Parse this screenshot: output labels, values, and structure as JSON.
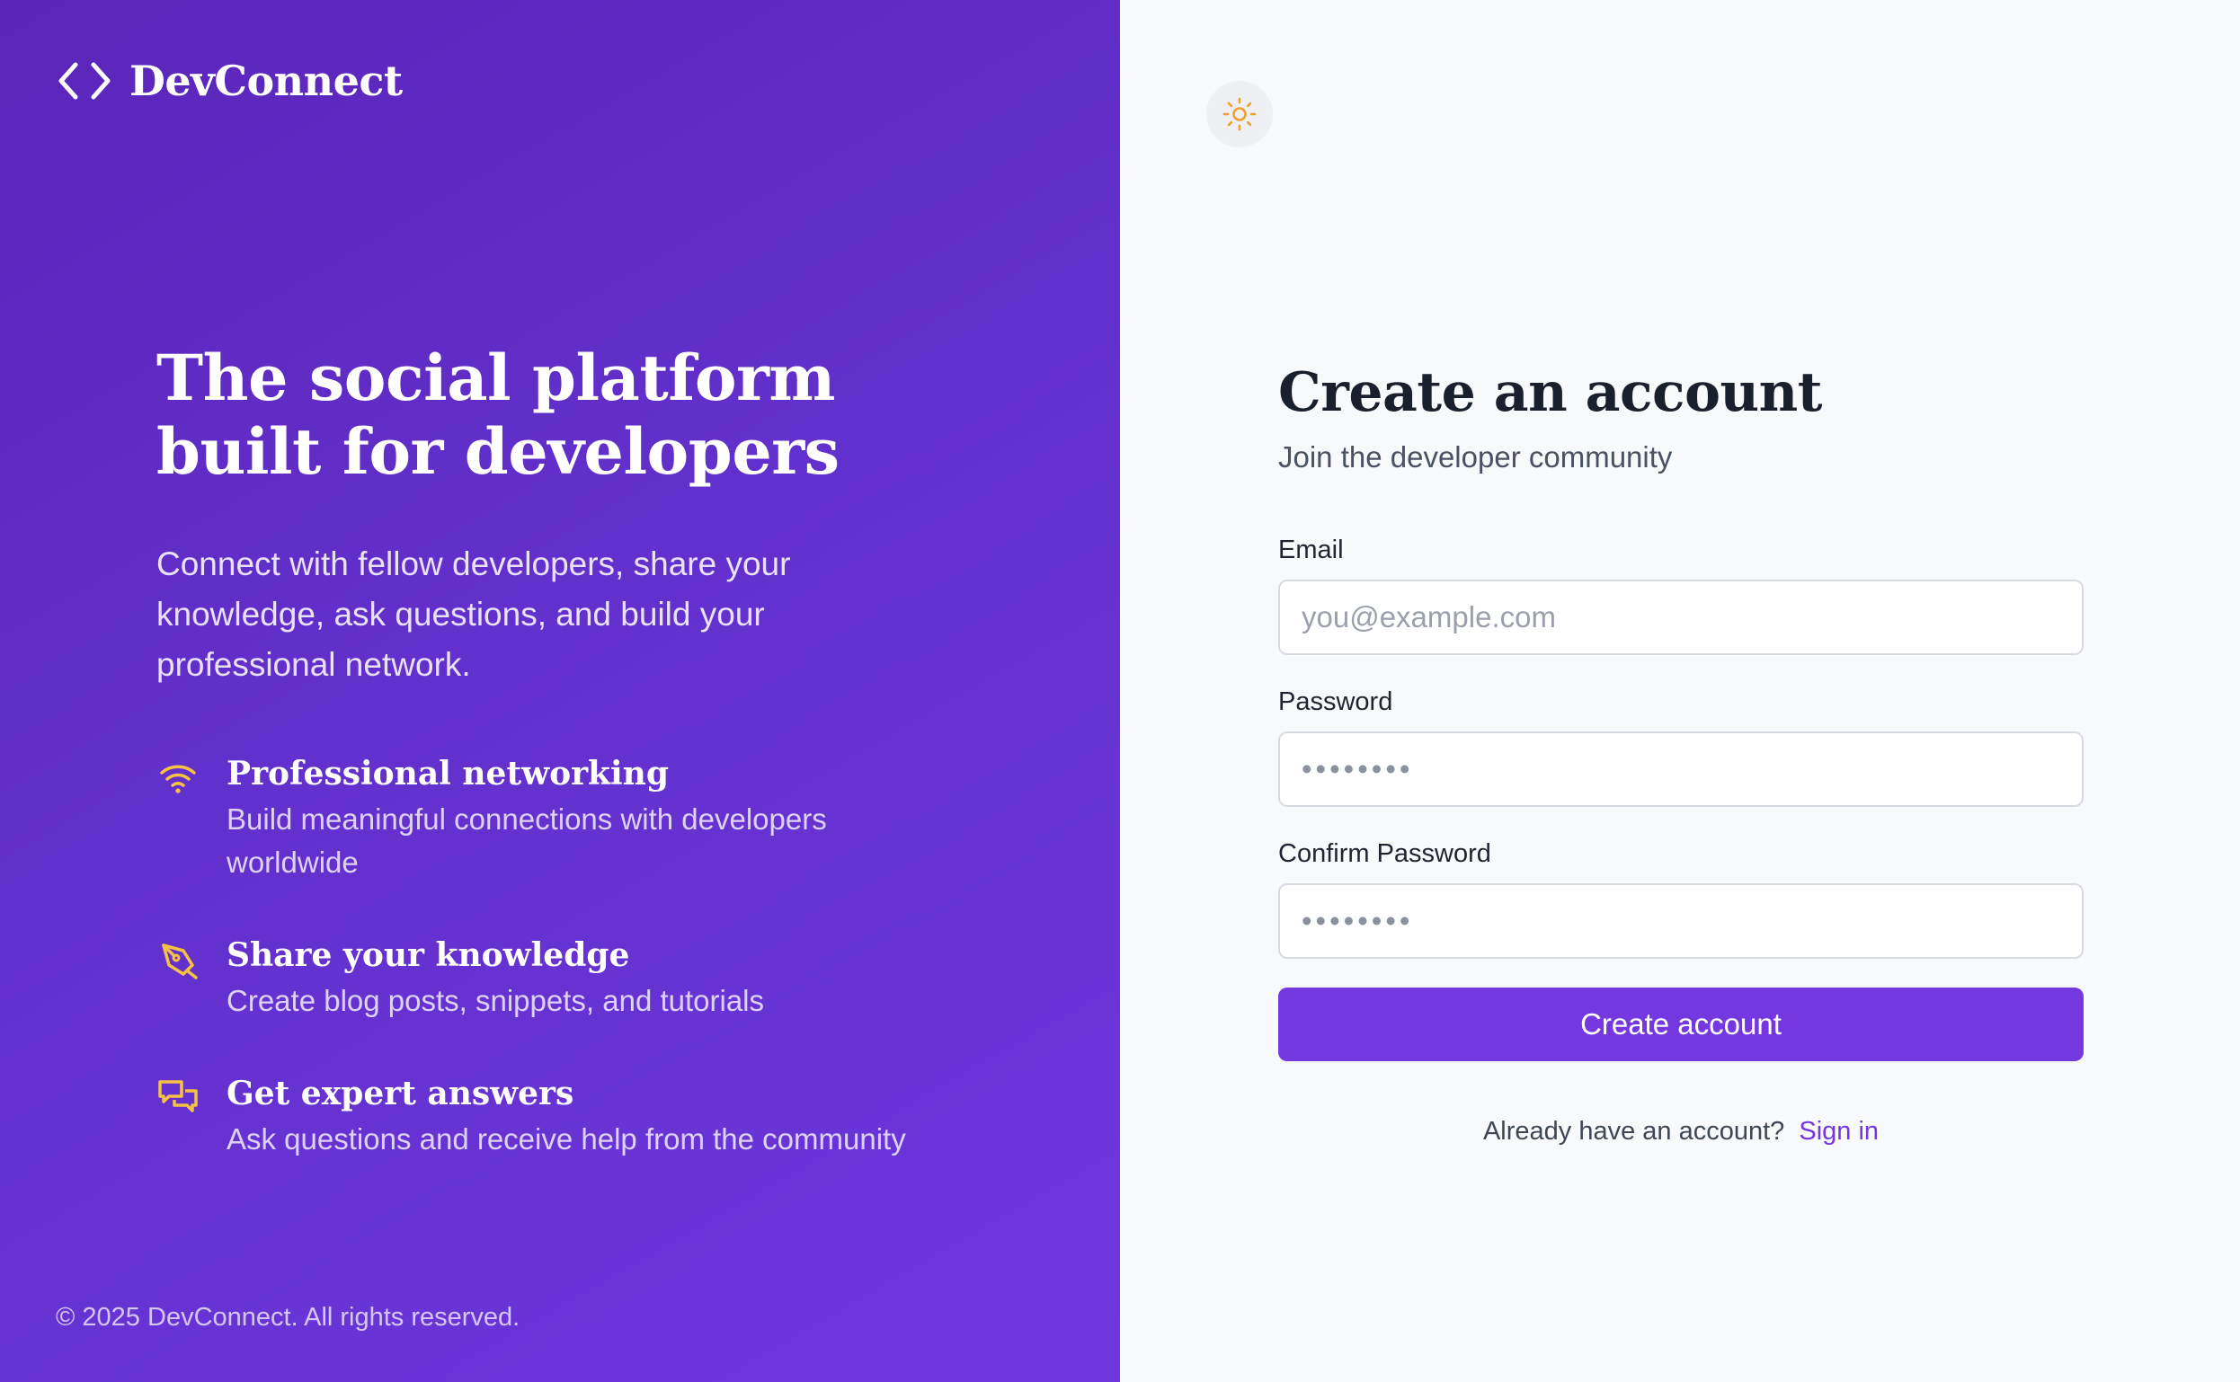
{
  "brand": {
    "name": "DevConnect",
    "logo_icon": "code-brackets-icon"
  },
  "hero": {
    "title": "The social platform built for developers",
    "description": "Connect with fellow developers, share your knowledge, ask questions, and build your professional network.",
    "features": [
      {
        "icon": "wifi-icon",
        "title": "Professional networking",
        "description": "Build meaningful connections with developers worldwide"
      },
      {
        "icon": "pen-tool-icon",
        "title": "Share your knowledge",
        "description": "Create blog posts, snippets, and tutorials"
      },
      {
        "icon": "chat-bubbles-icon",
        "title": "Get expert answers",
        "description": "Ask questions and receive help from the community"
      }
    ],
    "copyright": "© 2025 DevConnect. All rights reserved."
  },
  "theme_toggle": {
    "icon": "sun-icon"
  },
  "form": {
    "title": "Create an account",
    "subtitle": "Join the developer community",
    "email": {
      "label": "Email",
      "placeholder": "you@example.com",
      "value": ""
    },
    "password": {
      "label": "Password",
      "placeholder": "••••••••",
      "value": ""
    },
    "confirm_password": {
      "label": "Confirm Password",
      "placeholder": "••••••••",
      "value": ""
    },
    "submit_label": "Create account",
    "signin_prompt": "Already have an account?",
    "signin_link": "Sign in"
  },
  "colors": {
    "hero_gradient_start": "#5b25b9",
    "hero_gradient_end": "#6d37dd",
    "accent": "#7538e0",
    "feature_icon": "#f5c243",
    "sun_icon": "#f0a030",
    "form_background": "#f8f9fb"
  }
}
